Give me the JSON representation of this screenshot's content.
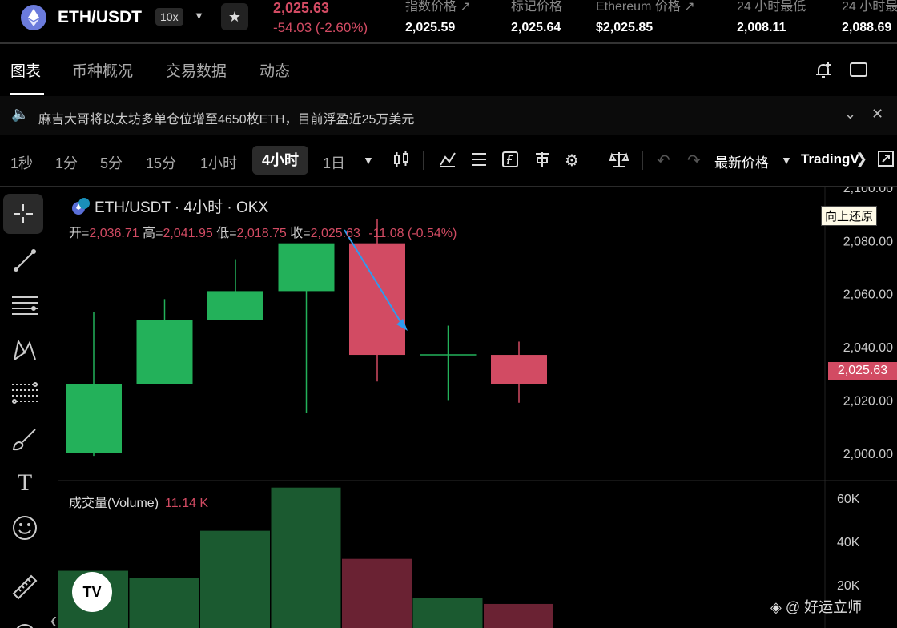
{
  "header": {
    "pair": "ETH/USDT",
    "leverage": "10x",
    "last_price": "2,025.63",
    "change": "-54.03 (-2.60%)",
    "stats": [
      {
        "label": "指数价格 ↗",
        "value": "2,025.59"
      },
      {
        "label": "标记价格",
        "value": "2,025.64"
      },
      {
        "label": "Ethereum 价格 ↗",
        "value": "$2,025.85"
      },
      {
        "label": "24 小时最低",
        "value": "2,008.11"
      },
      {
        "label": "24 小时最",
        "value": "2,088.69"
      }
    ]
  },
  "tabs": [
    "图表",
    "币种概况",
    "交易数据",
    "动态"
  ],
  "notice": "麻吉大哥将以太坊多单仓位增至4650枚ETH，目前浮盈近25万美元",
  "intervals": [
    "1秒",
    "1分",
    "5分",
    "15分",
    "1小时",
    "4小时",
    "1日"
  ],
  "active_interval": "4小时",
  "toolbar": {
    "price_source": "最新价格",
    "trading_view": "TradingV"
  },
  "legend": {
    "title": "ETH/USDT · 4小时 · OKX",
    "open_label": "开=",
    "open": "2,036.71",
    "high_label": "高=",
    "high": "2,041.95",
    "low_label": "低=",
    "low": "2,018.75",
    "close_label": "收=",
    "close": "2,025.63",
    "change": "-11.08 (-0.54%)"
  },
  "restore_tooltip": "向上还原",
  "last_price_tag": "2,025.63",
  "volume": {
    "label": "成交量(Volume)",
    "value": "11.14 K"
  },
  "watermark": "◈ @ 好运立师",
  "colors": {
    "up": "#23b15a",
    "down": "#d24b63",
    "vol_up": "#1b5a30",
    "vol_down": "#6a2233",
    "arrow": "#2f9bf0"
  },
  "chart_data": {
    "type": "candlestick",
    "price_axis": {
      "ticks": [
        2000,
        2020,
        2040,
        2060,
        2080,
        2100
      ],
      "tick_labels": [
        "2,000.00",
        "2,020.00",
        "2,040.00",
        "2,060.00",
        "2,080.00",
        "2,100.00"
      ],
      "range": [
        1990,
        2100
      ]
    },
    "candles": [
      {
        "o": 2000,
        "h": 2053,
        "l": 1999,
        "c": 2026
      },
      {
        "o": 2026,
        "h": 2058,
        "l": 2026,
        "c": 2050
      },
      {
        "o": 2050,
        "h": 2073,
        "l": 2050,
        "c": 2061
      },
      {
        "o": 2061,
        "h": 2076,
        "l": 2015,
        "c": 2079
      },
      {
        "o": 2079,
        "h": 2088,
        "l": 2027,
        "c": 2037
      },
      {
        "o": 2037,
        "h": 2048,
        "l": 2020,
        "c": 2037
      },
      {
        "o": 2037,
        "h": 2042,
        "l": 2019,
        "c": 2026
      }
    ],
    "volume_axis": {
      "ticks": [
        20000,
        40000,
        60000
      ],
      "tick_labels": [
        "20K",
        "40K",
        "60K"
      ],
      "range": [
        0,
        66000
      ]
    },
    "volumes": [
      26500,
      23000,
      45000,
      65000,
      32000,
      14000,
      11140
    ]
  }
}
